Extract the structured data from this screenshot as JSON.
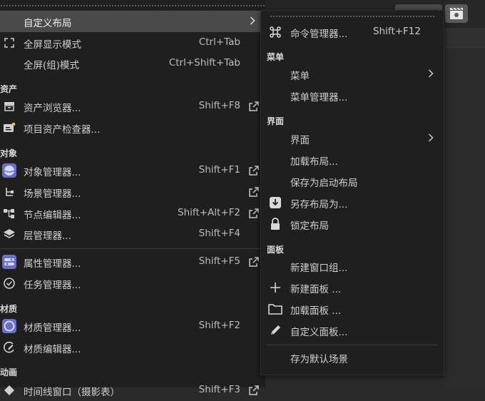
{
  "left_menu": {
    "items": [
      {
        "label": "自定义布局",
        "shortcut": "",
        "icon": "none"
      },
      {
        "label": "全屏显示模式",
        "shortcut": "Ctrl+Tab",
        "icon": "fullscreen-icon"
      },
      {
        "label": "全屏(组)模式",
        "shortcut": "Ctrl+Shift+Tab",
        "icon": "none"
      },
      {
        "label": "资产浏览器...",
        "shortcut": "Shift+F8",
        "icon": "asset-browser-icon"
      },
      {
        "label": "项目资产检查器...",
        "shortcut": "",
        "icon": "asset-inspector-icon"
      },
      {
        "label": "对象管理器...",
        "shortcut": "Shift+F1",
        "icon": "object-manager-icon"
      },
      {
        "label": "场景管理器...",
        "shortcut": "",
        "icon": "scene-manager-icon"
      },
      {
        "label": "节点编辑器...",
        "shortcut": "Shift+Alt+F2",
        "icon": "node-editor-icon"
      },
      {
        "label": "层管理器...",
        "shortcut": "Shift+F4",
        "icon": "layers-icon"
      },
      {
        "label": "属性管理器...",
        "shortcut": "Shift+F5",
        "icon": "attribute-manager-icon"
      },
      {
        "label": "任务管理器...",
        "shortcut": "",
        "icon": "task-manager-icon"
      },
      {
        "label": "材质管理器...",
        "shortcut": "Shift+F2",
        "icon": "material-manager-icon"
      },
      {
        "label": "材质编辑器...",
        "shortcut": "",
        "icon": "material-editor-icon"
      },
      {
        "label": "时间线窗口（摄影表）",
        "shortcut": "Shift+F3",
        "icon": "timeline-icon"
      }
    ],
    "sections": {
      "assets": "资产",
      "objects": "对象",
      "materials": "材质",
      "animation": "动画"
    }
  },
  "right_menu": {
    "items": [
      {
        "label": "命令管理器...",
        "shortcut": "Shift+F12",
        "icon": "command-icon"
      },
      {
        "label": "菜单",
        "shortcut": "",
        "icon": "none"
      },
      {
        "label": "菜单管理器...",
        "shortcut": "",
        "icon": "none"
      },
      {
        "label": "界面",
        "shortcut": "",
        "icon": "none"
      },
      {
        "label": "加载布局...",
        "shortcut": "",
        "icon": "none"
      },
      {
        "label": "保存为启动布局",
        "shortcut": "",
        "icon": "none"
      },
      {
        "label": "另存布局为...",
        "shortcut": "",
        "icon": "download-icon"
      },
      {
        "label": "锁定布局",
        "shortcut": "",
        "icon": "lock-icon"
      },
      {
        "label": "新建窗口组...",
        "shortcut": "",
        "icon": "none"
      },
      {
        "label": "新建面板 ...",
        "shortcut": "",
        "icon": "plus-icon"
      },
      {
        "label": "加载面板 ...",
        "shortcut": "",
        "icon": "folder-icon"
      },
      {
        "label": "自定义面板...",
        "shortcut": "",
        "icon": "pencil-icon"
      },
      {
        "label": "存为默认场景",
        "shortcut": "",
        "icon": "none"
      }
    ],
    "sections": {
      "menu": "菜单",
      "interface": "界面",
      "panel": "面板"
    }
  },
  "colors": {
    "menu_bg": "#1f1f1f",
    "highlight": "#4a4a4a",
    "accent_purple": "#6b6fc4"
  }
}
